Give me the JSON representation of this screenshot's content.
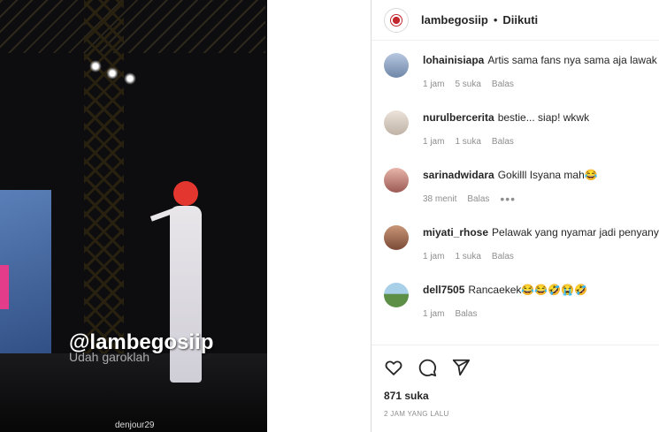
{
  "post": {
    "username": "lambegosiip",
    "separator": "•",
    "follow_status": "Diikuti"
  },
  "media": {
    "watermark": "@lambegosiip",
    "watermark_sub": "Udah garoklah",
    "credit": "denjour29"
  },
  "comments": [
    {
      "user": "lohainisiapa",
      "text": "Artis sama fans nya sama aja lawak 🤣",
      "time": "1 jam",
      "likes": "5 suka",
      "reply": "Balas",
      "avatar_color": "#8fa7c9"
    },
    {
      "user": "nurulbercerita",
      "text": "bestie... siap! wkwk",
      "time": "1 jam",
      "likes": "1 suka",
      "reply": "Balas",
      "avatar_color": "#d9cfc6"
    },
    {
      "user": "sarinadwidara",
      "text": "Gokilll Isyana mah😂",
      "time": "38 menit",
      "likes": "",
      "reply": "Balas",
      "more": "•••",
      "avatar_color": "#c77f7a"
    },
    {
      "user": "miyati_rhose",
      "text": "Pelawak yang nyamar jadi penyanyi",
      "time": "1 jam",
      "likes": "1 suka",
      "reply": "Balas",
      "avatar_color": "#a7755c"
    },
    {
      "user": "dell7505",
      "text": "Rancaekek😂😂🤣😭🤣",
      "time": "1 jam",
      "likes": "",
      "reply": "Balas",
      "avatar_color": "#6f9f5a"
    }
  ],
  "actions": {
    "like_icon": "heart-icon",
    "comment_icon": "comment-icon",
    "share_icon": "send-icon",
    "likes": "871 suka",
    "posted": "2 JAM YANG LALU"
  }
}
